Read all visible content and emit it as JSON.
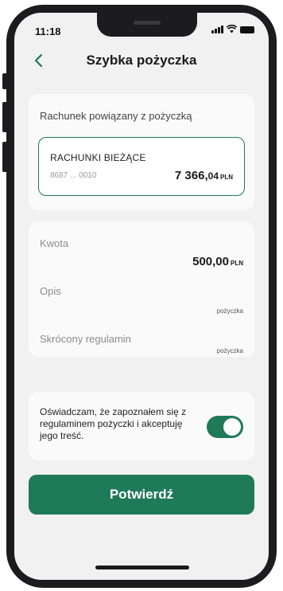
{
  "status_bar": {
    "time": "11:18"
  },
  "header": {
    "title": "Szybka pożyczka"
  },
  "account_section": {
    "label": "Rachunek powiązany z pożyczką",
    "account_name": "RACHUNKI BIEŻĄCE",
    "account_number": "8687 ... 0010",
    "balance_main": "7 366,",
    "balance_decimals": "04",
    "currency": "PLN"
  },
  "details": {
    "amount_label": "Kwota",
    "amount_value": "500,00",
    "amount_currency": "PLN",
    "description_label": "Opis",
    "description_value": "pożyczka",
    "terms_label": "Skrócony regulamin",
    "terms_value": "pożyczka"
  },
  "consent": {
    "text": "Oświadczam, że zapoznałem się z regulaminem pożyczki i akceptuję jego treść.",
    "toggle_on": true
  },
  "actions": {
    "confirm_label": "Potwierdź"
  },
  "colors": {
    "accent": "#1f7a5a",
    "background": "#f1f1f1",
    "card": "#fafafa"
  }
}
